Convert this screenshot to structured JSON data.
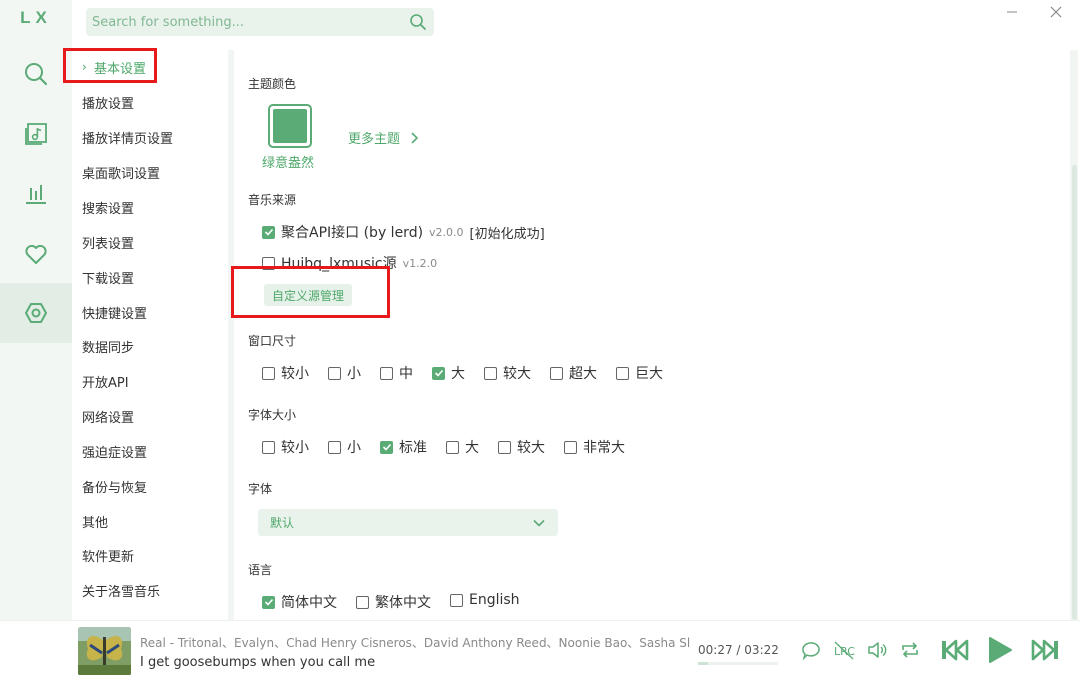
{
  "app": {
    "logo": "LX"
  },
  "rail": [
    {
      "icon": "search-icon"
    },
    {
      "icon": "music-library-icon"
    },
    {
      "icon": "leaderboard-icon"
    },
    {
      "icon": "heart-icon"
    },
    {
      "icon": "settings-icon",
      "active": true
    }
  ],
  "search": {
    "placeholder": "Search for something..."
  },
  "nav": {
    "items": [
      {
        "label": "基本设置",
        "active": true
      },
      {
        "label": "播放设置"
      },
      {
        "label": "播放详情页设置"
      },
      {
        "label": "桌面歌词设置"
      },
      {
        "label": "搜索设置"
      },
      {
        "label": "列表设置"
      },
      {
        "label": "下载设置"
      },
      {
        "label": "快捷键设置"
      },
      {
        "label": "数据同步"
      },
      {
        "label": "开放API"
      },
      {
        "label": "网络设置"
      },
      {
        "label": "强迫症设置"
      },
      {
        "label": "备份与恢复"
      },
      {
        "label": "其他"
      },
      {
        "label": "软件更新"
      },
      {
        "label": "关于洛雪音乐"
      }
    ]
  },
  "settings": {
    "theme": {
      "title": "主题颜色",
      "current": "绿意盎然",
      "more": "更多主题",
      "color": "#5aab76"
    },
    "source": {
      "title": "音乐来源",
      "items": [
        {
          "label": "聚合API接口 (by lerd)",
          "version": "v2.0.0",
          "status": "[初始化成功]",
          "checked": true
        },
        {
          "label": "Huibq_lxmusic源",
          "version": "v1.2.0",
          "status": "",
          "checked": false
        }
      ],
      "manage_button": "自定义源管理"
    },
    "window_size": {
      "title": "窗口尺寸",
      "options": [
        {
          "label": "较小",
          "checked": false
        },
        {
          "label": "小",
          "checked": false
        },
        {
          "label": "中",
          "checked": false
        },
        {
          "label": "大",
          "checked": true
        },
        {
          "label": "较大",
          "checked": false
        },
        {
          "label": "超大",
          "checked": false
        },
        {
          "label": "巨大",
          "checked": false
        }
      ]
    },
    "font_size": {
      "title": "字体大小",
      "options": [
        {
          "label": "较小",
          "checked": false
        },
        {
          "label": "小",
          "checked": false
        },
        {
          "label": "标准",
          "checked": true
        },
        {
          "label": "大",
          "checked": false
        },
        {
          "label": "较大",
          "checked": false
        },
        {
          "label": "非常大",
          "checked": false
        }
      ]
    },
    "font": {
      "title": "字体",
      "value": "默认"
    },
    "language": {
      "title": "语言",
      "options": [
        {
          "label": "简体中文",
          "checked": true
        },
        {
          "label": "繁体中文",
          "checked": false
        },
        {
          "label": "English",
          "checked": false
        }
      ]
    }
  },
  "player": {
    "artist_line": "Real - Tritonal、Evalyn、Chad Henry Cisneros、David Anthony Reed、Noonie Bao、Sasha Sloa...",
    "lyric": "I get goosebumps when you call me",
    "current_time": "00:27",
    "separator": "/",
    "total_time": "03:22",
    "progress": 0.13
  },
  "colors": {
    "accent": "#5aab76",
    "highlight_box": "#e8191b"
  }
}
